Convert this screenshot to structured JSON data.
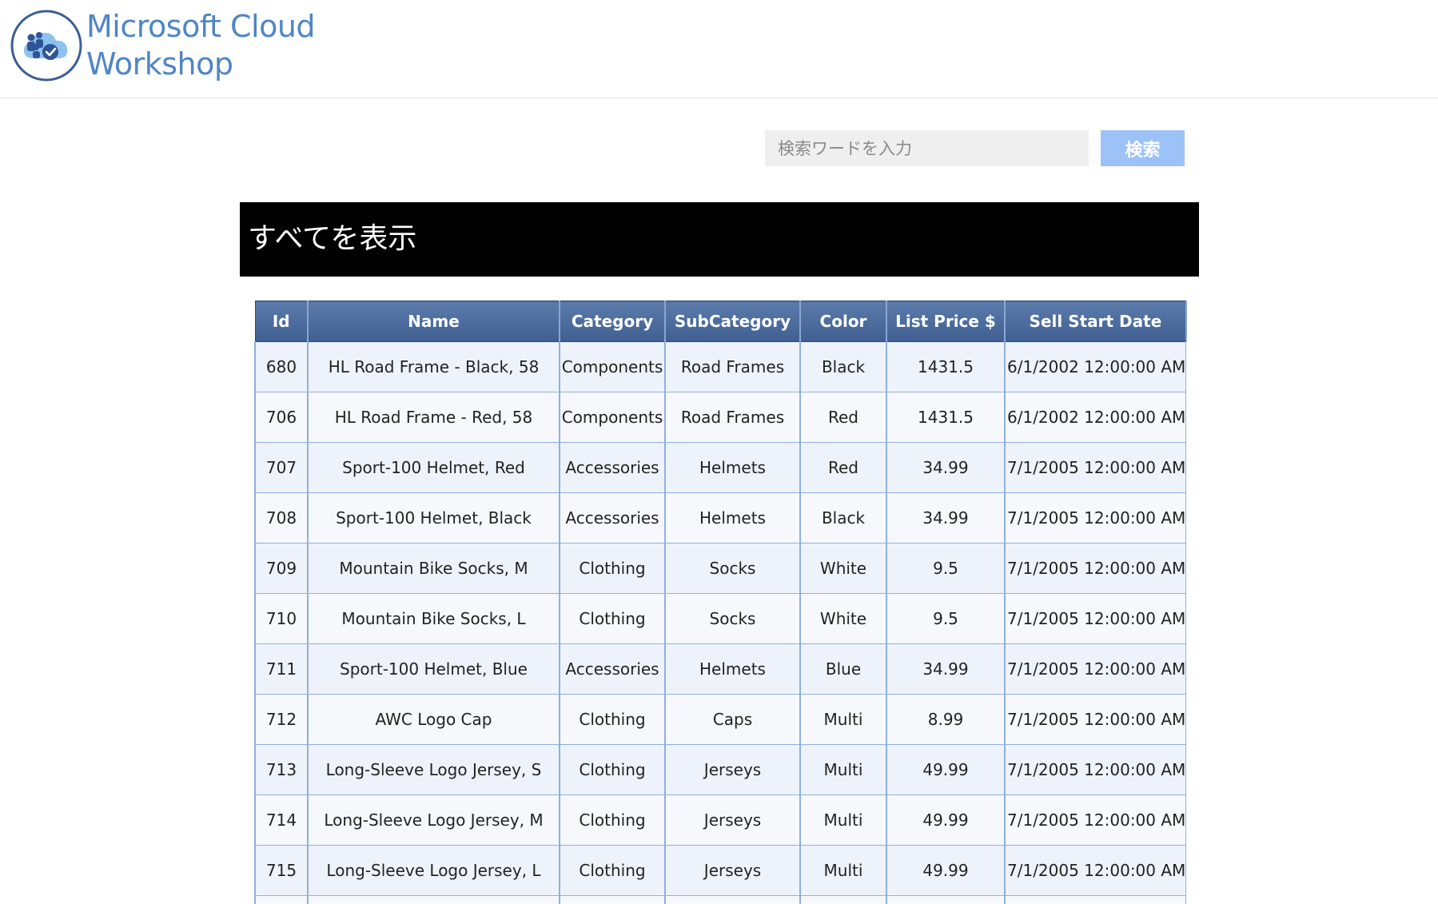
{
  "header": {
    "logo_line1": "Microsoft Cloud",
    "logo_line2": "Workshop"
  },
  "search": {
    "placeholder": "検索ワードを入力",
    "button_label": "検索"
  },
  "title": "すべてを表示",
  "table": {
    "columns": [
      "Id",
      "Name",
      "Category",
      "SubCategory",
      "Color",
      "List Price $",
      "Sell Start Date"
    ],
    "rows": [
      [
        "680",
        "HL Road Frame - Black, 58",
        "Components",
        "Road Frames",
        "Black",
        "1431.5",
        "6/1/2002 12:00:00 AM"
      ],
      [
        "706",
        "HL Road Frame - Red, 58",
        "Components",
        "Road Frames",
        "Red",
        "1431.5",
        "6/1/2002 12:00:00 AM"
      ],
      [
        "707",
        "Sport-100 Helmet, Red",
        "Accessories",
        "Helmets",
        "Red",
        "34.99",
        "7/1/2005 12:00:00 AM"
      ],
      [
        "708",
        "Sport-100 Helmet, Black",
        "Accessories",
        "Helmets",
        "Black",
        "34.99",
        "7/1/2005 12:00:00 AM"
      ],
      [
        "709",
        "Mountain Bike Socks, M",
        "Clothing",
        "Socks",
        "White",
        "9.5",
        "7/1/2005 12:00:00 AM"
      ],
      [
        "710",
        "Mountain Bike Socks, L",
        "Clothing",
        "Socks",
        "White",
        "9.5",
        "7/1/2005 12:00:00 AM"
      ],
      [
        "711",
        "Sport-100 Helmet, Blue",
        "Accessories",
        "Helmets",
        "Blue",
        "34.99",
        "7/1/2005 12:00:00 AM"
      ],
      [
        "712",
        "AWC Logo Cap",
        "Clothing",
        "Caps",
        "Multi",
        "8.99",
        "7/1/2005 12:00:00 AM"
      ],
      [
        "713",
        "Long-Sleeve Logo Jersey, S",
        "Clothing",
        "Jerseys",
        "Multi",
        "49.99",
        "7/1/2005 12:00:00 AM"
      ],
      [
        "714",
        "Long-Sleeve Logo Jersey, M",
        "Clothing",
        "Jerseys",
        "Multi",
        "49.99",
        "7/1/2005 12:00:00 AM"
      ],
      [
        "715",
        "Long-Sleeve Logo Jersey, L",
        "Clothing",
        "Jerseys",
        "Multi",
        "49.99",
        "7/1/2005 12:00:00 AM"
      ]
    ]
  },
  "colors": {
    "brand": "#4f86c6",
    "header_row": "#4a6a9e",
    "search_button": "#9cc2f7",
    "title_bar": "#000000"
  }
}
